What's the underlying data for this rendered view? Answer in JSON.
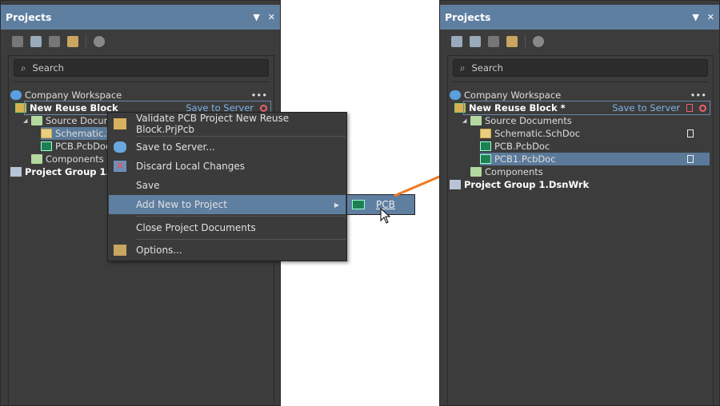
{
  "left": {
    "title": "Projects",
    "search_placeholder": "Search",
    "workspace": "Company Workspace",
    "more": "•••",
    "project": "New Reuse Block",
    "save_to_server": "Save to Server",
    "source_docs": "Source Documents",
    "files": [
      "Schematic.SchDoc",
      "PCB.PcbDoc"
    ],
    "components": "Components",
    "group": "Project Group 1.DsnWrk"
  },
  "right": {
    "title": "Projects",
    "search_placeholder": "Search",
    "workspace": "Company Workspace",
    "more": "•••",
    "project": "New Reuse Block *",
    "save_to_server": "Save to Server",
    "source_docs": "Source Documents",
    "files": [
      "Schematic.SchDoc",
      "PCB.PcbDoc",
      "PCB1.PcbDoc"
    ],
    "components": "Components",
    "group": "Project Group 1.DsnWrk"
  },
  "menu": {
    "items": [
      "Validate PCB Project New Reuse Block.PrjPcb",
      "Save to Server...",
      "Discard Local Changes",
      "Save",
      "Add New to Project",
      "Close Project Documents",
      "Options..."
    ],
    "submenu": "PCB"
  },
  "colors": {
    "accent": "#5f7fa1",
    "arrow": "#f07820"
  }
}
